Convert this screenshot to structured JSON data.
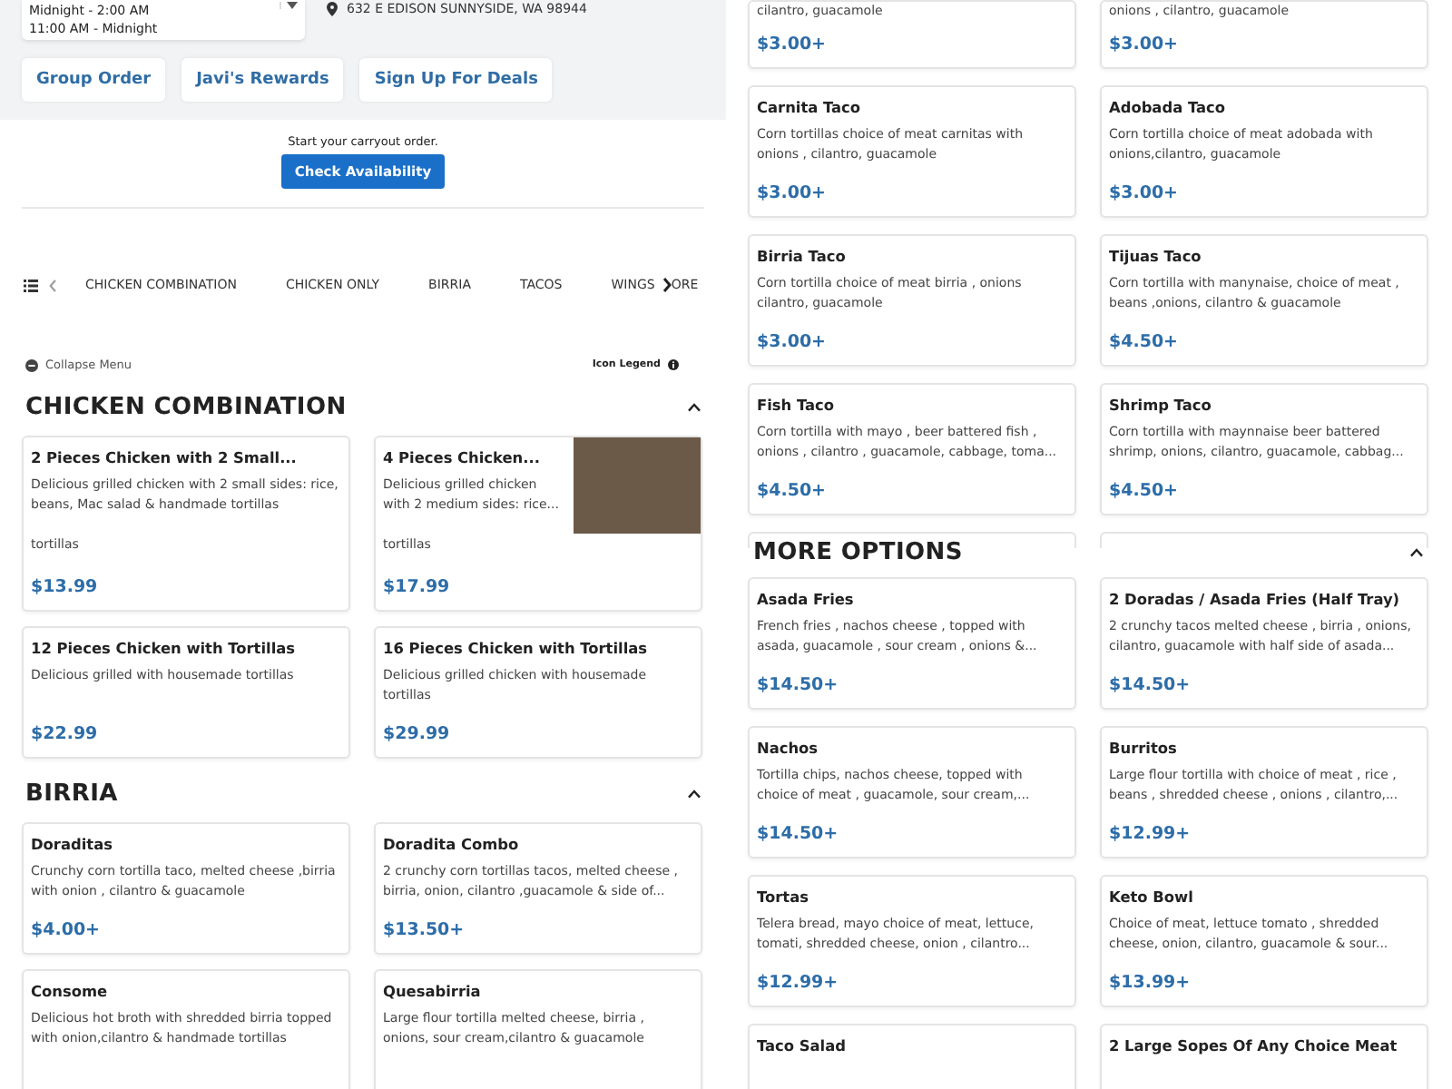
{
  "hours_dropdown": {
    "lines": [
      "Midnight - 2:00 AM",
      "11:00 AM - Midnight"
    ]
  },
  "address": "632 E EDISON SUNNYSIDE, WA 98944",
  "header_buttons": [
    "Group Order",
    "Javi's Rewards",
    "Sign Up For Deals"
  ],
  "carryout": {
    "prompt": "Start your carryout order.",
    "button": "Check Availability"
  },
  "category_nav": {
    "items": [
      "CHICKEN COMBINATION",
      "CHICKEN ONLY",
      "BIRRIA",
      "TACOS",
      "WINGS",
      "ORE"
    ]
  },
  "collapse_menu": "Collapse Menu",
  "icon_legend": "Icon Legend",
  "left_sections": [
    {
      "title": "CHICKEN COMBINATION",
      "items": [
        {
          "name": "2 Pieces Chicken with 2 Small...",
          "description": "Delicious grilled chicken with 2 small sides: rice, beans, Mac salad & handmade tortillas",
          "extra": "tortillas",
          "price": "$13.99"
        },
        {
          "name": "4 Pieces Chicken...",
          "description": "Delicious grilled chicken with 2 medium sides: rice...",
          "extra": "tortillas",
          "price": "$17.99",
          "photo": true
        },
        {
          "name": "12 Pieces Chicken with Tortillas",
          "description": "Delicious grilled with housemade tortillas",
          "price": "$22.99"
        },
        {
          "name": "16 Pieces Chicken with Tortillas",
          "description": "Delicious grilled chicken with housemade tortillas",
          "price": "$29.99"
        }
      ]
    },
    {
      "title": "BIRRIA",
      "items": [
        {
          "name": "Doraditas",
          "description": "Crunchy corn tortilla taco, melted cheese ,birria with onion , cilantro & guacamole",
          "price": "$4.00+"
        },
        {
          "name": "Doradita Combo",
          "description": "2 crunchy corn tortillas tacos, melted cheese , birria, onion, cilantro ,guacamole & side of...",
          "price": "$13.50+"
        },
        {
          "name": "Consome",
          "description": "Delicious hot broth with shredded birria topped with onion,cilantro & handmade tortillas"
        },
        {
          "name": "Quesabirria",
          "description": "Large flour tortilla melted cheese, birria , onions, sour cream,cilantro & guacamole"
        }
      ]
    }
  ],
  "right_top_items": [
    {
      "description": "cilantro, guacamole",
      "price": "$3.00+"
    },
    {
      "description": "onions , cilantro, guacamole",
      "price": "$3.00+"
    },
    {
      "name": "Carnita Taco",
      "description": "Corn tortillas choice of meat carnitas with onions , cilantro, guacamole",
      "price": "$3.00+"
    },
    {
      "name": "Adobada Taco",
      "description": "Corn tortilla choice of meat adobada with onions,cilantro, guacamole",
      "price": "$3.00+"
    },
    {
      "name": "Birria Taco",
      "description": "Corn tortilla choice of meat birria , onions cilantro, guacamole",
      "price": "$3.00+"
    },
    {
      "name": "Tijuas Taco",
      "description": "Corn tortilla with manynaise, choice of meat , beans ,onions, cilantro & guacamole",
      "price": "$4.50+"
    },
    {
      "name": "Fish Taco",
      "description": "Corn tortilla with mayo , beer battered fish , onions , cilantro , guacamole, cabbage, toma...",
      "price": "$4.50+"
    },
    {
      "name": "Shrimp Taco",
      "description": "Corn tortilla with maynnaise beer battered shrimp, onions, cilantro, guacamole, cabbag...",
      "price": "$4.50+"
    }
  ],
  "right_sections": [
    {
      "title": "MORE OPTIONS",
      "items": [
        {
          "name": "Asada Fries",
          "description": "French fries , nachos cheese , topped with asada, guacamole , sour cream , onions &...",
          "price": "$14.50+"
        },
        {
          "name": "2 Doradas / Asada Fries (Half Tray)",
          "description": "2 crunchy tacos melted cheese , birria , onions, cilantro, guacamole with half side of asada...",
          "price": "$14.50+"
        },
        {
          "name": "Nachos",
          "description": "Tortilla chips, nachos cheese, topped with choice of meat , guacamole, sour cream,...",
          "price": "$14.50+"
        },
        {
          "name": "Burritos",
          "description": "Large flour tortilla with choice of meat , rice , beans , shredded cheese , onions , cilantro,...",
          "price": "$12.99+"
        },
        {
          "name": "Tortas",
          "description": "Telera bread, mayo choice of meat, lettuce, tomati, shredded cheese, onion , cilantro...",
          "price": "$12.99+"
        },
        {
          "name": "Keto Bowl",
          "description": "Choice of meat, lettuce tomato , shredded cheese, onion, cilantro, guacamole & sour...",
          "price": "$13.99+"
        },
        {
          "name": "Taco Salad"
        },
        {
          "name": "2 Large Sopes Of Any Choice Meat"
        }
      ]
    }
  ]
}
